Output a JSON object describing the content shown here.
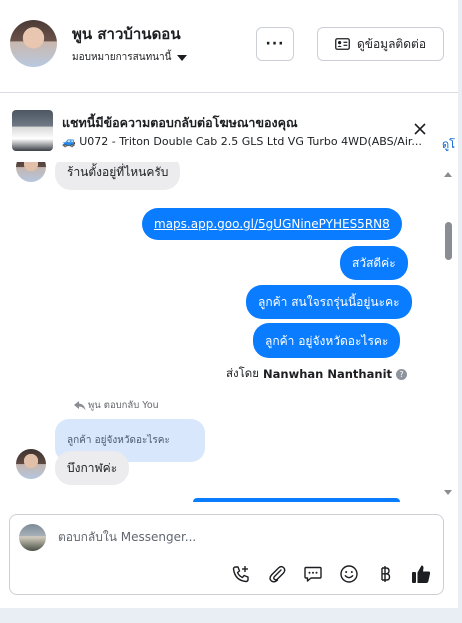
{
  "header": {
    "name": "พูน สาวบ้านดอน",
    "assign_label": "มอบหมายการสนทนานี้",
    "more_label": "···",
    "contact_label": "ดูข้อมูลติดต่อ"
  },
  "banner": {
    "title": "แชทนี้มีข้อความตอบกลับต่อโฆษณาของคุณ",
    "subtitle": "🚙 U072 - Triton Double Cab 2.5 GLS Ltd VG Turbo 4WD(ABS/Air...",
    "link": "ดูโ"
  },
  "messages": {
    "incoming_partial": "ร้านตั้งอยู่ที่ไหนครับ",
    "outgoing": [
      "maps.app.goo.gl/5gUGNinePYHES5RN8",
      "สวัสดีค่ะ",
      "ลูกค้า สนใจรถรุ่นนี้อยู่นะคะ",
      "ลูกค้า อยู่จังหวัดอะไรคะ"
    ],
    "sent_by_prefix": "ส่งโดย",
    "sent_by_name": "Nanwhan Nanthanit",
    "help_glyph": "?",
    "reply_label": "พูน ตอบกลับ You",
    "reply_quote": "ลูกค้า อยู่จังหวัดอะไรคะ",
    "reply_text": "บึงกาฬค่ะ"
  },
  "composer": {
    "placeholder": "ตอบกลับใน Messenger..."
  },
  "tools": [
    "call-add-icon",
    "paperclip-icon",
    "chat-bubble-icon",
    "emoji-icon",
    "baht-icon",
    "thumbs-up-icon"
  ],
  "colors": {
    "accent": "#0a7cff",
    "incoming": "#ececef",
    "reply_quote": "#d8e7fb"
  }
}
